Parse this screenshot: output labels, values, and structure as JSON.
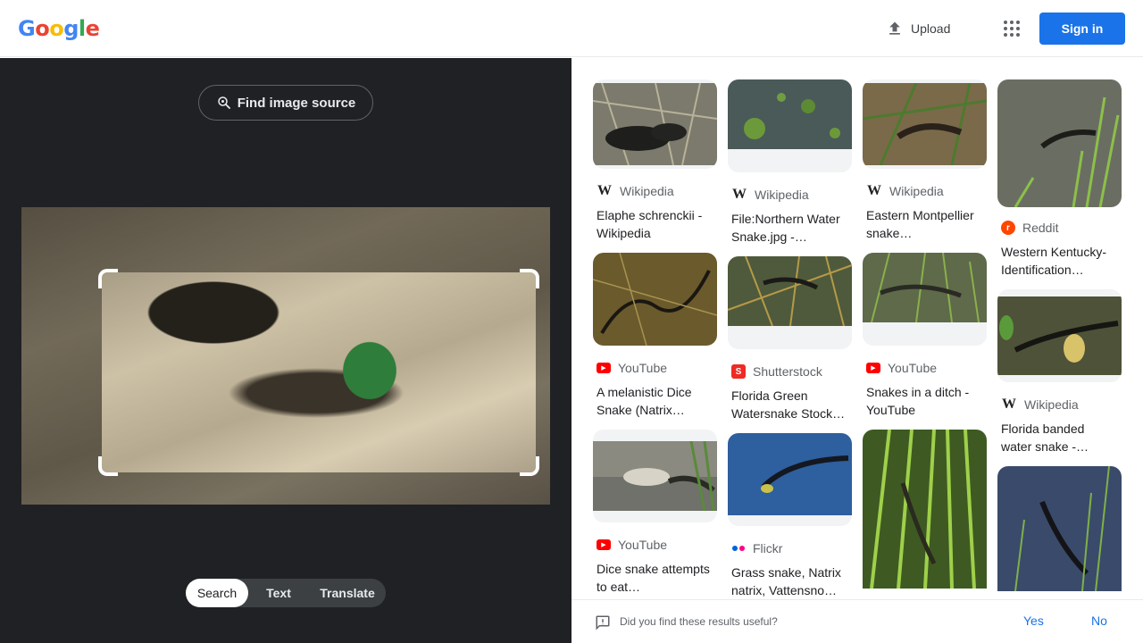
{
  "header": {
    "logo_text": "Google",
    "upload_label": "Upload",
    "signin_label": "Sign in",
    "colors": {
      "blue": "#4285F4",
      "red": "#EA4335",
      "yellow": "#FBBC05",
      "green": "#34A853",
      "accent": "#1a73e8"
    }
  },
  "lens": {
    "find_source_label": "Find image source",
    "modes": [
      "Search",
      "Text",
      "Translate"
    ],
    "active_mode": "Search"
  },
  "results": {
    "col1": [
      {
        "source": "Wikipedia",
        "icon": "wikipedia-icon",
        "title": "Elaphe schrenckii - Wikipedia"
      },
      {
        "source": "YouTube",
        "icon": "youtube-icon",
        "title": "A melanistic Dice Snake (Natrix…"
      },
      {
        "source": "YouTube",
        "icon": "youtube-icon",
        "title": "Dice snake attempts to eat…"
      }
    ],
    "col2": [
      {
        "source": "Wikipedia",
        "icon": "wikipedia-icon",
        "title": "File:Northern Water Snake.jpg -…"
      },
      {
        "source": "Shutterstock",
        "icon": "shutterstock-icon",
        "title": "Florida Green Watersnake Stock…"
      },
      {
        "source": "Flickr",
        "icon": "flickr-icon",
        "title": "Grass snake, Natrix natrix, Vattensno…"
      }
    ],
    "col3": [
      {
        "source": "Wikipedia",
        "icon": "wikipedia-icon",
        "title": "Eastern Montpellier snake…"
      },
      {
        "source": "YouTube",
        "icon": "youtube-icon",
        "title": "Snakes in a ditch - YouTube"
      }
    ],
    "col4": [
      {
        "source": "Reddit",
        "icon": "reddit-icon",
        "title": "Western Kentucky-Identification…"
      },
      {
        "source": "Wikipedia",
        "icon": "wikipedia-icon",
        "title": "Florida banded water snake -…"
      }
    ]
  },
  "feedback": {
    "question": "Did you find these results useful?",
    "yes_label": "Yes",
    "no_label": "No"
  }
}
